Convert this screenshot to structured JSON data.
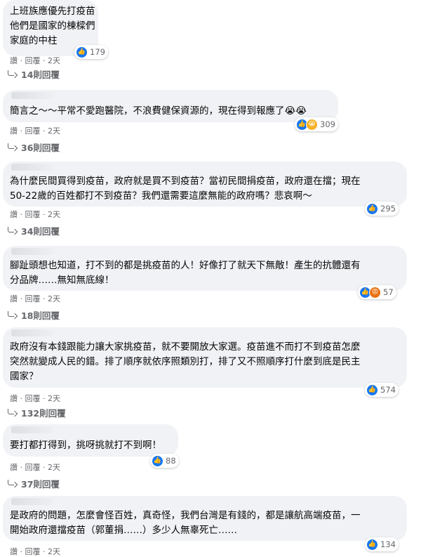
{
  "comments": [
    {
      "text": "上班族應優先打疫苗\n他們是國家的棟樑們\n家庭的中柱",
      "reactions": "179",
      "actions": "讚 · 回覆 · 2天",
      "replies": "14則回覆"
    },
    {
      "text": "簡言之～～平常不愛跑醫院，不浪費健保資源的，現在得到報應了😭😭",
      "reactions": "309",
      "actions": "讚 · 回覆 · 2天",
      "replies": "36則回覆"
    },
    {
      "text": "為什麼民間買得到疫苗，政府就是買不到疫苗？當初民間捐疫苗，政府還在擋；現在\n50-22歲的百姓都打不到疫苗？我們還需要這麼無能的政府嗎？悲哀啊～",
      "reactions": "295",
      "actions": "讚 · 回覆 · 2天",
      "replies": "34則回覆"
    },
    {
      "text": "腳趾頭想也知道，打不到的都是挑疫苗的人！好像打了就天下無敵！產生的抗體還有\n分品牌……無知無底線！",
      "reactions": "57",
      "actions": "讚 · 回覆 · 2天",
      "replies": "18則回覆"
    },
    {
      "text": "政府沒有本錢跟能力讓大家挑疫苗，就不要開放大家選。疫苗進不而打不到疫苗怎麼\n突然就變成人民的錯。排了順序就依序照類別打，排了又不照順序打什麼到底是民主\n國家？",
      "reactions": "574",
      "actions": "讚 · 回覆 · 2天",
      "replies": "132則回覆"
    },
    {
      "text": "要打都打得到，挑呀挑就打不到啊！",
      "reactions": "88",
      "actions": "讚 · 回覆 · 2天",
      "replies": "37則回覆"
    },
    {
      "text": "是政府的問題，怎麼會怪百姓，真奇怪，我們台灣是有錢的，都是讓航高端疫苗，一\n開始政府還擋疫苗（郭董捐……）多少人無辜死亡……",
      "reactions": "134",
      "actions": "讚 · 回覆 · 2天",
      "replies": ""
    }
  ]
}
